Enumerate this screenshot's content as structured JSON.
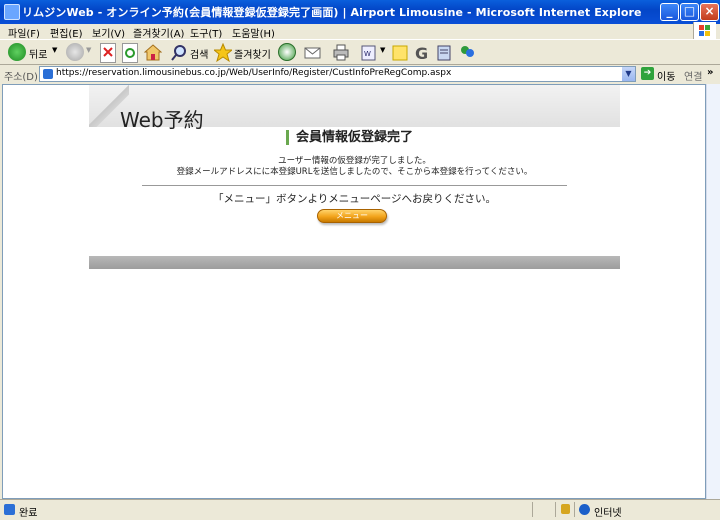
{
  "window": {
    "title": "リムジンWeb - オンライン予約(会員情報登録仮登録完了画面) | Airport Limousine - Microsoft Internet Explorer",
    "min_label": "_",
    "max_label": "□",
    "close_label": "×"
  },
  "menu": {
    "items": [
      "파일(F)",
      "편집(E)",
      "보기(V)",
      "즐겨찾기(A)",
      "도구(T)",
      "도움말(H)"
    ]
  },
  "toolbar": {
    "back_label": "뒤로",
    "search_label": "검색",
    "favorites_label": "즐겨찾기"
  },
  "address": {
    "label": "주소(D)",
    "url": "https://reservation.limousinebus.co.jp/Web/UserInfo/Register/CustInfoPreRegComp.aspx",
    "go_label": "이동",
    "links_label": "연결",
    "more_label": "»"
  },
  "page": {
    "banner_title": "Web予約",
    "heading": "会員情報仮登録完了",
    "message_line1": "ユーザー情報の仮登録が完了しました。",
    "message_line2": "登録メールアドレスにに本登録URLを送信しましたので、そこから本登録を行ってください。",
    "menu_message": "「メニュー」ボタンよりメニューページへお戻りください。",
    "menu_button": "メニュー"
  },
  "status": {
    "text": "완료",
    "zone": "인터넷"
  },
  "colors": {
    "title_bar": "#0a52d6",
    "menu_button": "#f2a31b",
    "heading_accent": "#6aa84f"
  }
}
